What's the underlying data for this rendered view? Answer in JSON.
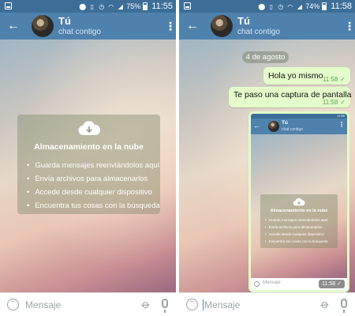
{
  "left_screen": {
    "status": {
      "battery": "75%",
      "time": "11:55"
    },
    "header": {
      "title": "Tú",
      "subtitle": "chat contigo"
    },
    "cloud_card": {
      "title": "Almacenamiento en la nube",
      "items": [
        "Guarda mensajes reenviándolos aquí",
        "Envía archivos para almacenarlos",
        "Accede desde cualquier dispositivo",
        "Encuentra tus cosas con la búsqueda"
      ]
    },
    "input": {
      "placeholder": "Mensaje"
    }
  },
  "right_screen": {
    "status": {
      "battery": "74%",
      "time": "11:58"
    },
    "header": {
      "title": "Tú",
      "subtitle": "chat contigo"
    },
    "date_badge": "4 de agosto",
    "messages": [
      {
        "text": "Hola yo mismo",
        "time": "11:58"
      },
      {
        "text": "Te paso una captura de pantalla",
        "time": "11:58"
      }
    ],
    "screenshot_message": {
      "status_time": "11:55",
      "header_title": "Tú",
      "header_subtitle": "chat contigo",
      "card_title": "Almacenamiento en la nube",
      "card_items": [
        "Guarda mensajes reenviándolos aquí",
        "Envía archivos para almacenarlos",
        "Accede desde cualquier dispositivo",
        "Encuentra tus cosas con la búsqueda"
      ],
      "input_placeholder": "Mensaje",
      "time": "11:58"
    },
    "input": {
      "placeholder": "Mensaje"
    }
  },
  "colors": {
    "status_bar": "#3c6e98",
    "app_bar": "#4f81ad",
    "outgoing_bubble": "#e4fccb",
    "check": "#5fa05a"
  },
  "icons": {
    "back": "arrow-left-icon",
    "menu": "more-vertical-icon",
    "cloud": "cloud-download-icon",
    "emoji": "emoji-icon",
    "attach": "paperclip-icon",
    "mic": "microphone-icon",
    "check": "check-icon"
  }
}
